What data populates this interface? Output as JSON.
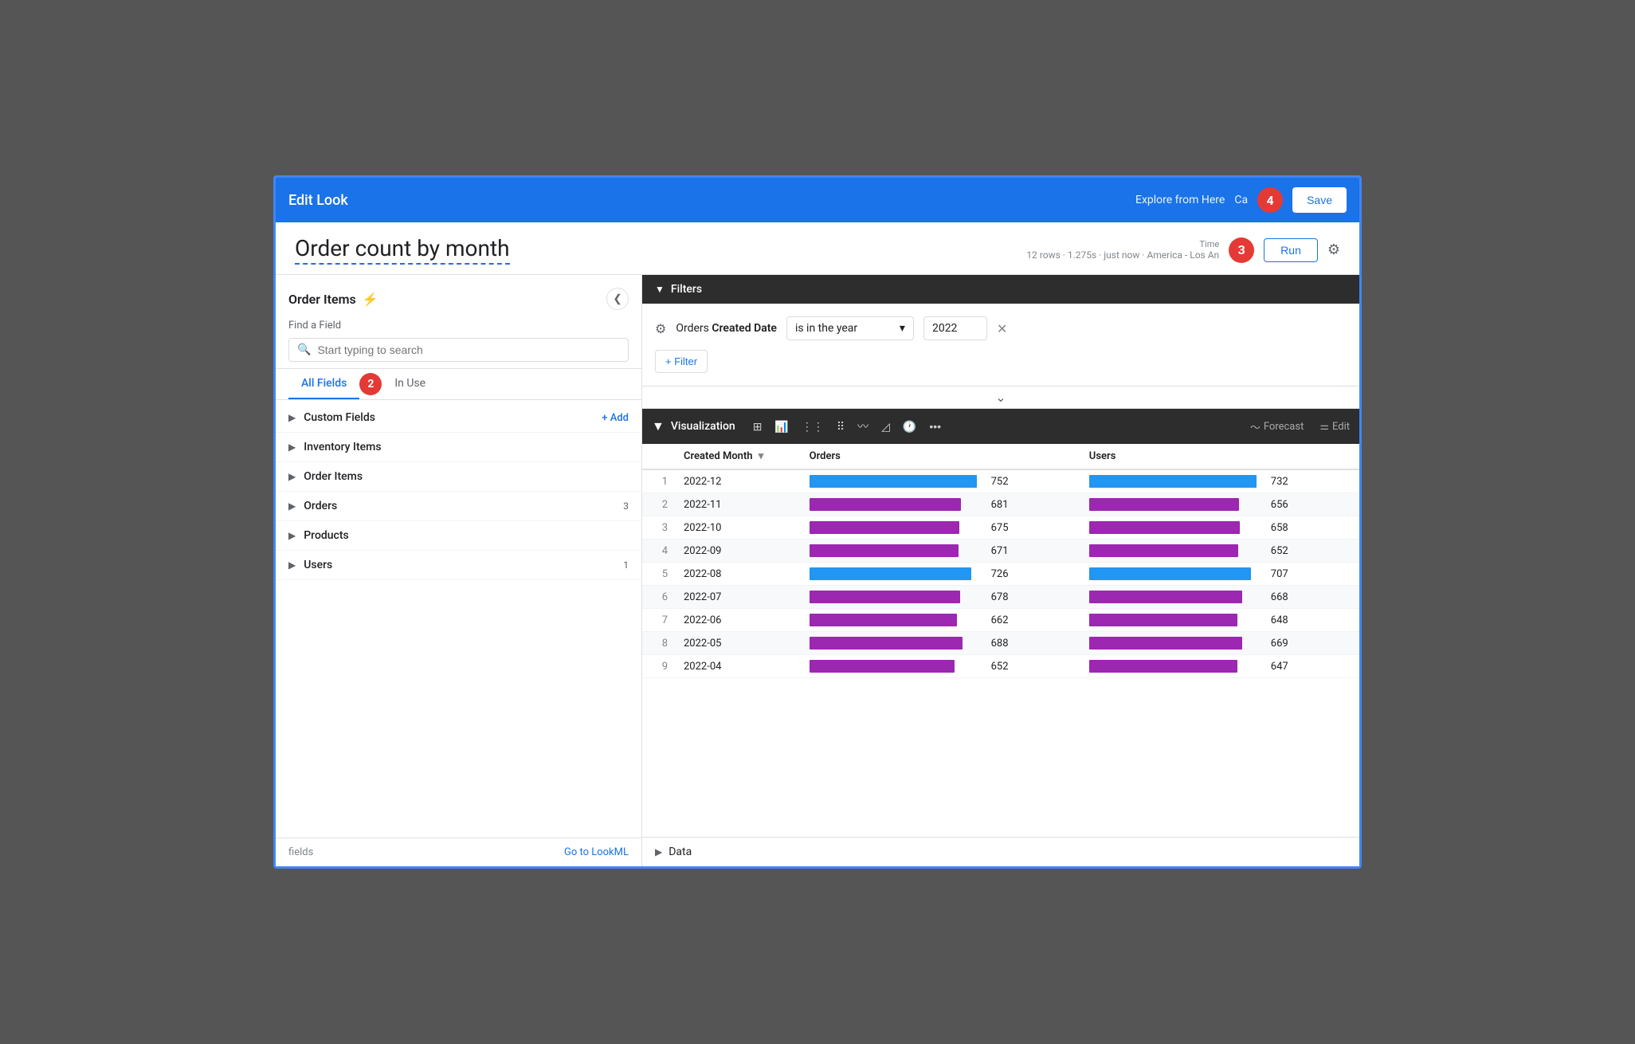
{
  "header": {
    "title": "Edit Look",
    "explore_link": "Explore from Here",
    "cancel_label": "Ca",
    "save_label": "Save",
    "step4_label": "4"
  },
  "title_bar": {
    "look_name": "Order count by month",
    "meta": "12 rows · 1.275s · just now · America - Los An",
    "time_label": "Time",
    "run_label": "Run"
  },
  "sidebar": {
    "title": "Order Items",
    "find_label": "Find a Field",
    "search_placeholder": "Start typing to search",
    "tabs": [
      {
        "label": "All Fields",
        "active": true
      },
      {
        "label": "In Use",
        "active": false
      }
    ],
    "step2_label": "2",
    "groups": [
      {
        "name": "Custom Fields",
        "count": null,
        "add_link": "+ Add"
      },
      {
        "name": "Inventory Items",
        "count": null,
        "add_link": null
      },
      {
        "name": "Order Items",
        "count": null,
        "add_link": null
      },
      {
        "name": "Orders",
        "count": "3",
        "add_link": null
      },
      {
        "name": "Products",
        "count": null,
        "add_link": null
      },
      {
        "name": "Users",
        "count": "1",
        "add_link": null
      }
    ],
    "footer_label": "fields",
    "lml_link": "Go to LookML"
  },
  "filters": {
    "section_label": "Filters",
    "filter_items": [
      {
        "field_name": "Orders",
        "field_bold": "Created Date",
        "operator": "is in the year",
        "value": "2022"
      }
    ],
    "add_filter_label": "+ Filter"
  },
  "visualization": {
    "section_label": "Visualization",
    "forecast_label": "Forecast",
    "edit_label": "Edit",
    "columns": [
      "",
      "Created Month",
      "Orders",
      "Users"
    ],
    "rows": [
      {
        "num": "1",
        "month": "2022-12",
        "orders": 752,
        "users": 732,
        "orders_pct": 100,
        "users_pct": 97,
        "orders_color": "#2196f3",
        "users_color": "#2196f3"
      },
      {
        "num": "2",
        "month": "2022-11",
        "orders": 681,
        "users": 656,
        "orders_pct": 91,
        "users_pct": 87,
        "orders_color": "#9c27b0",
        "users_color": "#9c27b0"
      },
      {
        "num": "3",
        "month": "2022-10",
        "orders": 675,
        "users": 658,
        "orders_pct": 90,
        "users_pct": 87,
        "orders_color": "#9c27b0",
        "users_color": "#9c27b0"
      },
      {
        "num": "4",
        "month": "2022-09",
        "orders": 671,
        "users": 652,
        "orders_pct": 89,
        "users_pct": 87,
        "orders_color": "#9c27b0",
        "users_color": "#9c27b0"
      },
      {
        "num": "5",
        "month": "2022-08",
        "orders": 726,
        "users": 707,
        "orders_pct": 97,
        "users_pct": 94,
        "orders_color": "#2196f3",
        "users_color": "#2196f3"
      },
      {
        "num": "6",
        "month": "2022-07",
        "orders": 678,
        "users": 668,
        "orders_pct": 90,
        "users_pct": 89,
        "orders_color": "#9c27b0",
        "users_color": "#9c27b0"
      },
      {
        "num": "7",
        "month": "2022-06",
        "orders": 662,
        "users": 648,
        "orders_pct": 88,
        "users_pct": 86,
        "orders_color": "#9c27b0",
        "users_color": "#9c27b0"
      },
      {
        "num": "8",
        "month": "2022-05",
        "orders": 688,
        "users": 669,
        "orders_pct": 92,
        "users_pct": 89,
        "orders_color": "#9c27b0",
        "users_color": "#9c27b0"
      },
      {
        "num": "9",
        "month": "2022-04",
        "orders": 652,
        "users": 647,
        "orders_pct": 87,
        "users_pct": 86,
        "orders_color": "#9c27b0",
        "users_color": "#9c27b0"
      }
    ]
  },
  "data_section": {
    "label": "Data"
  }
}
